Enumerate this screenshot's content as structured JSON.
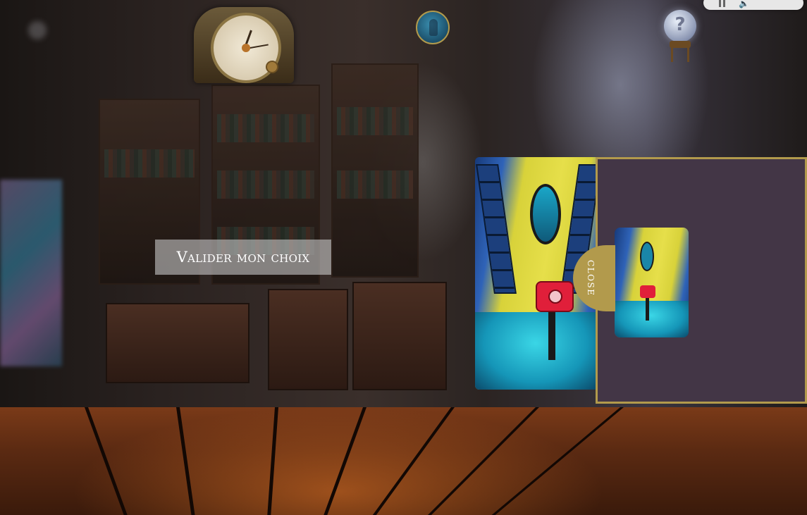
{
  "game": {
    "validate_label": "Valider mon choix",
    "close_label": "CLOSE",
    "help_symbol": "?"
  },
  "icons": {
    "clock": "antique-clock-icon",
    "medallion": "portrait-medallion-icon",
    "help": "crystal-ball-help-icon",
    "pause": "pause-icon",
    "volume": "volume-icon"
  },
  "colors": {
    "accent_gold": "#b29a4c",
    "panel_bg": "#433646",
    "validate_bg": "rgba(200,200,200,0.6)"
  },
  "selection": {
    "card": "telephone-card",
    "selected_thumbnail": "telephone-card"
  }
}
